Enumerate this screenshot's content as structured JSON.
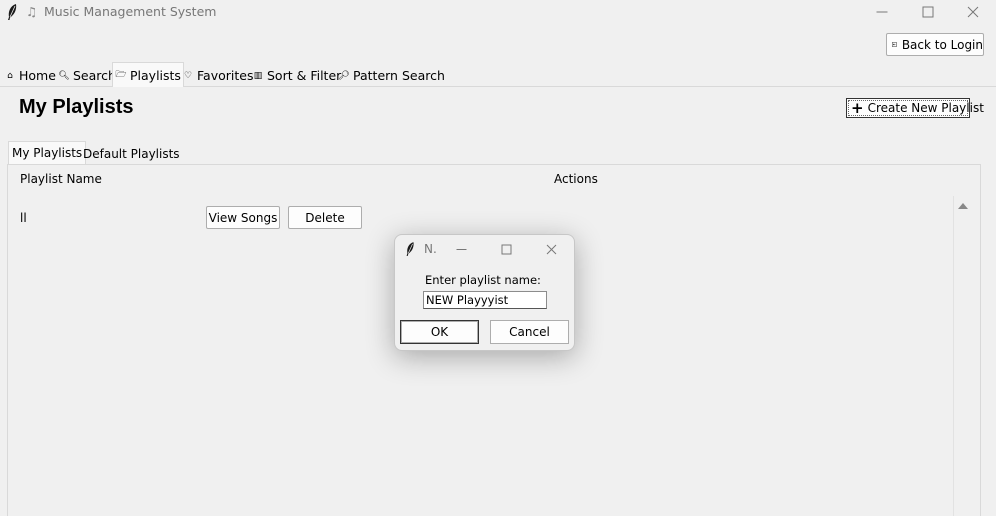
{
  "window": {
    "title": "Music Management System",
    "icons": {
      "app": "feather-icon",
      "title_note": "music-note-icon"
    }
  },
  "header": {
    "back_button": "Back to Login"
  },
  "main_tabs": [
    {
      "label": "Home",
      "icon": "home-icon"
    },
    {
      "label": "Search",
      "icon": "search-icon"
    },
    {
      "label": "Playlists",
      "icon": "folder-icon",
      "active": true
    },
    {
      "label": "Favorites",
      "icon": "heart-icon"
    },
    {
      "label": "Sort & Filter",
      "icon": "chart-icon"
    },
    {
      "label": "Pattern Search",
      "icon": "magnifier-icon"
    }
  ],
  "page": {
    "title": "My Playlists",
    "create_button": "Create New Playlist",
    "sub_tabs": [
      {
        "label": "My Playlists",
        "active": true
      },
      {
        "label": "Default Playlists"
      }
    ],
    "columns": {
      "name": "Playlist Name",
      "actions": "Actions"
    },
    "rows": [
      {
        "name": "ll",
        "view_button": "View Songs",
        "delete_button": "Delete"
      }
    ]
  },
  "dialog": {
    "title": "N.",
    "prompt": "Enter playlist name:",
    "input_value": "NEW Playyyist",
    "ok": "OK",
    "cancel": "Cancel"
  }
}
